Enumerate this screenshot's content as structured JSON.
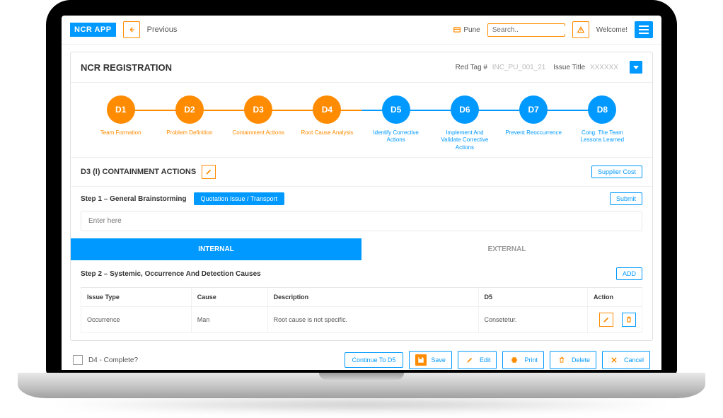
{
  "app": {
    "logo": "NCR APP"
  },
  "topbar": {
    "previous": "Previous",
    "location": "Pune",
    "search_placeholder": "Search..",
    "welcome": "Welcome!"
  },
  "registration": {
    "title": "NCR REGISTRATION",
    "red_tag_label": "Red Tag #",
    "red_tag_value": "INC_PU_001_21",
    "issue_title_label": "Issue Title",
    "issue_title_value": "XXXXXX"
  },
  "steps": [
    {
      "code": "D1",
      "label": "Team Formation",
      "color": "orange"
    },
    {
      "code": "D2",
      "label": "Problem Definition",
      "color": "orange"
    },
    {
      "code": "D3",
      "label": "Containment Actions",
      "color": "orange"
    },
    {
      "code": "D4",
      "label": "Root Cause Analysis",
      "color": "orange"
    },
    {
      "code": "D5",
      "label": "Identify Corrective Actions",
      "color": "blue"
    },
    {
      "code": "D6",
      "label": "Implement And Validate Corrective Actions",
      "color": "blue"
    },
    {
      "code": "D7",
      "label": "Prevent Reoccurrence",
      "color": "blue"
    },
    {
      "code": "D8",
      "label": "Cong. The Team Lessons Learned",
      "color": "blue"
    }
  ],
  "section": {
    "title": "D3 (I) CONTAINMENT ACTIONS",
    "supplier_cost": "Supplier Cost"
  },
  "step1": {
    "label": "Step 1 – General Brainstorming",
    "chip": "Quotation Issue / Transport",
    "submit": "Submit",
    "placeholder": "Enter here"
  },
  "tabs": {
    "internal": "INTERNAL",
    "external": "EXTERNAL"
  },
  "step2": {
    "title": "Step 2 – Systemic, Occurrence And Detection Causes",
    "add": "ADD"
  },
  "table": {
    "headers": {
      "issue_type": "Issue Type",
      "cause": "Cause",
      "description": "Description",
      "d5": "D5",
      "action": "Action"
    },
    "rows": [
      {
        "issue_type": "Occurrence",
        "cause": "Man",
        "description": "Root cause is not specific.",
        "d5": "Consetetur."
      }
    ]
  },
  "footer": {
    "d4_complete": "D4 - Complete?",
    "continue": "Continue To D5",
    "save": "Save",
    "edit": "Edit",
    "print": "Print",
    "delete": "Delete",
    "cancel": "Cancel"
  }
}
